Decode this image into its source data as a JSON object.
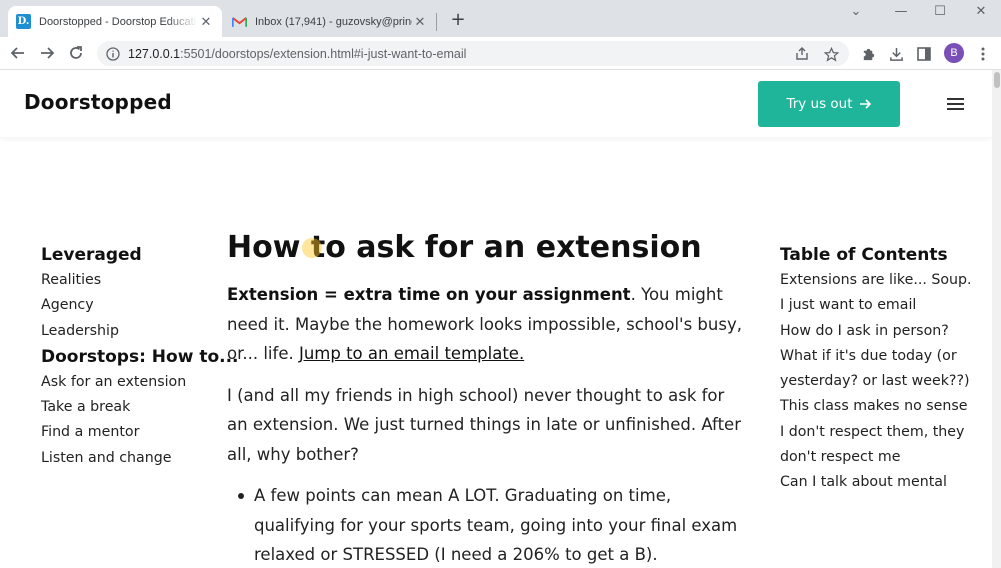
{
  "browser": {
    "tabs": [
      {
        "title": "Doorstopped - Doorstop Educati",
        "favicon": "D.",
        "active": true
      },
      {
        "title": "Inbox (17,941) - guzovsky@princ",
        "favicon": "gmail-icon",
        "active": false
      }
    ],
    "url_host": "127.0.0.1",
    "url_path": ":5501/doorstops/extension.html#i-just-want-to-email",
    "profile_initial": "B"
  },
  "header": {
    "brand": "Doorstopped",
    "cta_label": "Try us out",
    "cta_color": "#1fb59a"
  },
  "sidebar": {
    "sections": [
      {
        "heading": "Leveraged",
        "links": [
          "Realities",
          "Agency",
          "Leadership"
        ]
      },
      {
        "heading": "Doorstops: How to...",
        "links": [
          "Ask for an extension",
          "Take a break",
          "Find a mentor",
          "Listen and change"
        ]
      }
    ]
  },
  "article": {
    "title": "How to ask for an extension",
    "intro_bold": "Extension = extra time on your assignment",
    "intro_text": ". You might need it. Maybe the homework looks impossible, school's busy, or... life. ",
    "intro_link": "Jump to an email template.",
    "para2": "I (and all my friends in high school) never thought to ask for an extension. We just turned things in late or unfinished. After all, why bother?",
    "bullet1": "A few points can mean A LOT. Graduating on time, qualifying for your sports team, going into your final exam relaxed or STRESSED (I need a 206% to get a B)."
  },
  "toc": {
    "heading": "Table of Contents",
    "items": [
      "Extensions are like... Soup.",
      "I just want to email",
      "How do I ask in person?",
      "What if it's due today (or yesterday? or last week??)",
      "This class makes no sense",
      "I don't respect them, they don't respect me",
      "Can I talk about mental"
    ]
  }
}
